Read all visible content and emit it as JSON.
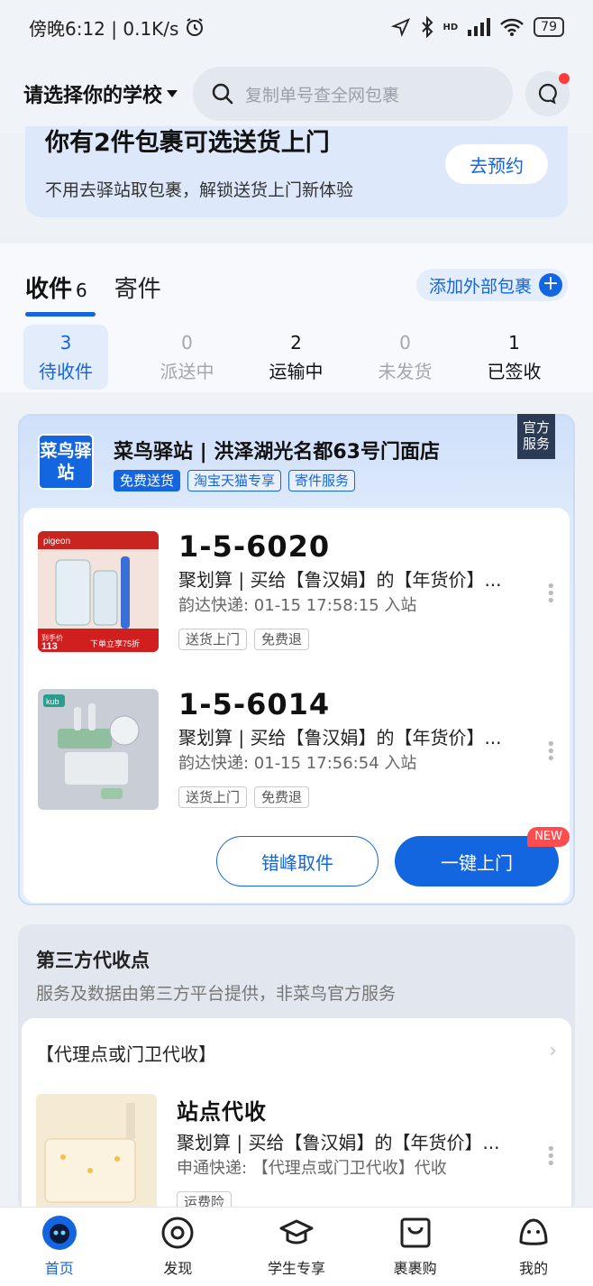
{
  "status_bar": {
    "time_speed": "傍晚6:12 | 0.1K/s",
    "battery": "79",
    "network": "HD"
  },
  "header": {
    "school_select": "请选择你的学校",
    "search_placeholder": "复制单号查全网包裹"
  },
  "promo": {
    "title": "你有2件包裹可选送货上门",
    "subtitle": "不用去驿站取包裹，解锁送货上门新体验",
    "button": "去预约"
  },
  "main_tabs": [
    {
      "label": "收件",
      "count": "6"
    },
    {
      "label": "寄件",
      "count": ""
    }
  ],
  "add_external": "添加外部包裹",
  "sub_tabs": [
    {
      "num": "3",
      "label": "待收件"
    },
    {
      "num": "0",
      "label": "派送中"
    },
    {
      "num": "2",
      "label": "运输中"
    },
    {
      "num": "0",
      "label": "未发货"
    },
    {
      "num": "1",
      "label": "已签收"
    }
  ],
  "station": {
    "logo": "菜鸟驿站",
    "name": "菜鸟驿站 | 洪泽湖光名都63号门面店",
    "tags": [
      "免费送货",
      "淘宝天猫专享",
      "寄件服务"
    ],
    "official_badge": "官方服务"
  },
  "packages": [
    {
      "code": "1-5-6020",
      "title": "聚划算 | 买给【鲁汉娟】的【年货价】...",
      "meta": "韵达快递: 01-15 17:58:15 入站",
      "tags": [
        "送货上门",
        "免费退"
      ],
      "img_text": [
        "pigeon",
        "到手价",
        "113",
        "下单立享75折"
      ]
    },
    {
      "code": "1-5-6014",
      "title": "聚划算 | 买给【鲁汉娟】的【年货价】...",
      "meta": "韵达快递: 01-15 17:56:54 入站",
      "tags": [
        "送货上门",
        "免费退"
      ],
      "img_text": [
        "kub"
      ]
    }
  ],
  "actions": {
    "off_peak": "错峰取件",
    "one_click": "一键上门",
    "new_badge": "NEW"
  },
  "third_party": {
    "title": "第三方代收点",
    "subtitle": "服务及数据由第三方平台提供，非菜鸟官方服务",
    "agent_title": "【代理点或门卫代收】",
    "package": {
      "code": "站点代收",
      "title": "聚划算 | 买给【鲁汉娟】的【年货价】...",
      "meta": "申通快递: 【代理点或门卫代收】代收",
      "tags": [
        "运费险"
      ]
    }
  },
  "bottom_nav": [
    {
      "label": "首页",
      "icon": "home-icon"
    },
    {
      "label": "发现",
      "icon": "discover-icon"
    },
    {
      "label": "学生专享",
      "icon": "graduation-cap-icon"
    },
    {
      "label": "裹裹购",
      "icon": "shopping-bag-icon"
    },
    {
      "label": "我的",
      "icon": "profile-icon"
    }
  ],
  "colors": {
    "accent": "#1466e0",
    "badge_red": "#ff4d4f"
  }
}
